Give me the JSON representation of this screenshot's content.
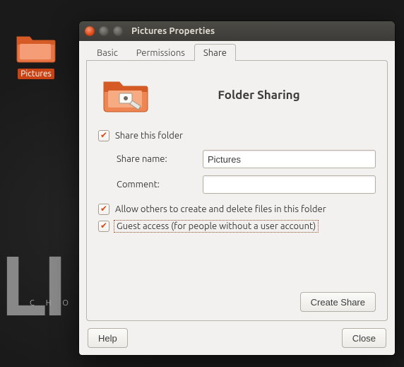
{
  "desktop": {
    "icon_label": "Pictures"
  },
  "window": {
    "title": "Pictures Properties"
  },
  "tabs": {
    "basic": "Basic",
    "permissions": "Permissions",
    "share": "Share"
  },
  "share": {
    "header": "Folder Sharing",
    "share_this_folder_label": "Share this folder",
    "share_name_label": "Share name:",
    "share_name_value": "Pictures",
    "comment_label": "Comment:",
    "comment_value": "",
    "allow_others_label": "Allow others to create and delete files in this folder",
    "guest_access_label": "Guest access (for people without a user account)",
    "create_share_button": "Create Share",
    "checkbox_share_this_folder": true,
    "checkbox_allow_others": true,
    "checkbox_guest_access": true
  },
  "buttons": {
    "help": "Help",
    "close": "Close"
  },
  "bg": {
    "big": "LI",
    "sub": "CHO"
  }
}
